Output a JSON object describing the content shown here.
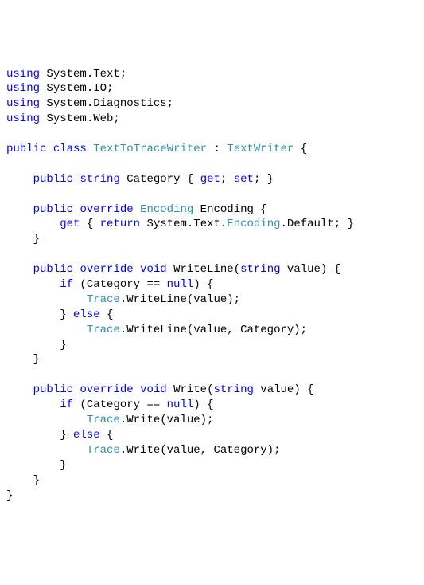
{
  "code": {
    "l1": {
      "a": "using",
      "b": " System.Text;"
    },
    "l2": {
      "a": "using",
      "b": " System.IO;"
    },
    "l3": {
      "a": "using",
      "b": " System.Diagnostics;"
    },
    "l4": {
      "a": "using",
      "b": " System.Web;"
    },
    "l5": {
      "a": "public",
      "b": "class",
      "c": "TextToTraceWriter",
      "d": " : ",
      "e": "TextWriter",
      "f": " {"
    },
    "l6": {
      "a": "public",
      "b": "string",
      "c": " Category { ",
      "d": "get",
      "e": "; ",
      "f": "set",
      "g": "; }"
    },
    "l7": {
      "a": "public",
      "b": "override",
      "c": "Encoding",
      "d": " Encoding {"
    },
    "l8": {
      "a": "get",
      "b": " { ",
      "c": "return",
      "d": " System.Text.",
      "e": "Encoding",
      "f": ".Default; }"
    },
    "l9": "    }",
    "l10": {
      "a": "public",
      "b": "override",
      "c": "void",
      "d": " WriteLine(",
      "e": "string",
      "f": " value) {"
    },
    "l11": {
      "a": "if",
      "b": " (Category == ",
      "c": "null",
      "d": ") {"
    },
    "l12": {
      "a": "Trace",
      "b": ".WriteLine(value);"
    },
    "l13": {
      "a": "        } ",
      "b": "else",
      "c": " {"
    },
    "l14": {
      "a": "Trace",
      "b": ".WriteLine(value, Category);"
    },
    "l15": "        }",
    "l16": "    }",
    "l17": {
      "a": "public",
      "b": "override",
      "c": "void",
      "d": " Write(",
      "e": "string",
      "f": " value) {"
    },
    "l18": {
      "a": "if",
      "b": " (Category == ",
      "c": "null",
      "d": ") {"
    },
    "l19": {
      "a": "Trace",
      "b": ".Write(value);"
    },
    "l20": {
      "a": "        } ",
      "b": "else",
      "c": " {"
    },
    "l21": {
      "a": "Trace",
      "b": ".Write(value, Category);"
    },
    "l22": "        }",
    "l23": "    }",
    "l24": "}"
  }
}
